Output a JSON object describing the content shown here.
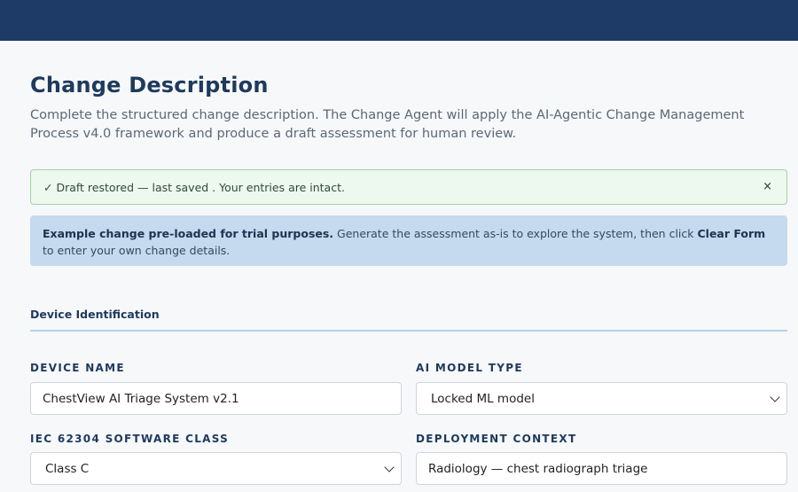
{
  "page": {
    "title": "Change Description",
    "intro": "Complete the structured change description. The Change Agent will apply the AI-Agentic Change Management Process v4.0 framework and produce a draft assessment for human review."
  },
  "alerts": {
    "draft": {
      "message": "✓ Draft restored — last saved . Your entries are intact.",
      "close": "×"
    },
    "example": {
      "bold_lead": "Example change pre-loaded for trial purposes.",
      "text_1": " Generate the assessment as-is to explore the system, then click ",
      "bold_action": "Clear Form",
      "text_2": " to enter your own change details."
    }
  },
  "section": {
    "title": "Device Identification"
  },
  "fields": {
    "device_name": {
      "label": "Device Name",
      "value": "ChestView AI Triage System v2.1"
    },
    "ai_model_type": {
      "label": "AI Model Type",
      "value": "Locked ML model"
    },
    "software_class": {
      "label": "IEC 62304 Software Class",
      "value": "Class C"
    },
    "deployment_context": {
      "label": "Deployment Context",
      "value": "Radiology — chest radiograph triage"
    }
  },
  "colors": {
    "header": "#1e3a66",
    "success_bg": "#edf8ee",
    "info_bg": "#c5d9ef",
    "heading": "#1e3a5c"
  },
  "icons": {
    "close": "close-icon",
    "dropdown": "chevron-down-icon"
  }
}
